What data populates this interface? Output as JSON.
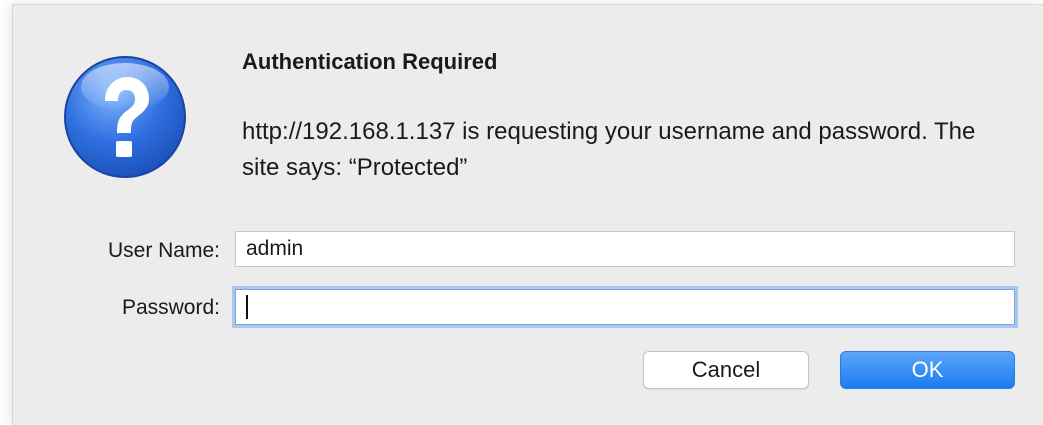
{
  "dialog": {
    "title": "Authentication Required",
    "message": "http://192.168.1.137 is requesting your username and password. The site says: “Protected”",
    "icon": "question-icon",
    "icon_color": "#2f6fe0"
  },
  "form": {
    "username_label": "User Name:",
    "username_value": "admin",
    "password_label": "Password:",
    "password_value": ""
  },
  "buttons": {
    "cancel_label": "Cancel",
    "ok_label": "OK",
    "ok_color": "#1a7cf0"
  }
}
